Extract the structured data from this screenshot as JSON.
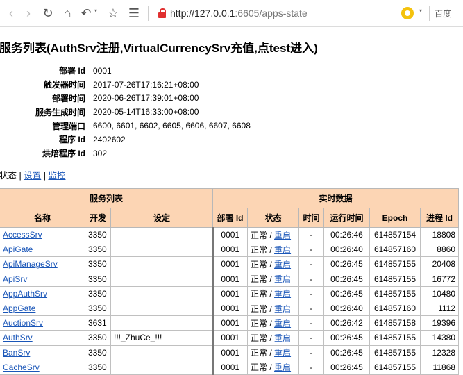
{
  "browser": {
    "url_host": "http://127.0.0.1",
    "url_rest": ":6605/apps-state",
    "search_engine": "百度"
  },
  "page": {
    "title": "服务列表(AuthSrv注册,VirtualCurrencySrv充值,点test进入)",
    "info": [
      {
        "label": "部署 Id",
        "value": "0001"
      },
      {
        "label": "触发器时间",
        "value": "2017-07-26T17:16:21+08:00"
      },
      {
        "label": "部署时间",
        "value": "2020-06-26T17:39:01+08:00"
      },
      {
        "label": "服务生成时间",
        "value": "2020-05-14T16:33:00+08:00"
      },
      {
        "label": "管理端口",
        "value": "6600, 6601, 6602, 6605, 6606, 6607, 6608"
      },
      {
        "label": "程序 Id",
        "value": "2402602"
      },
      {
        "label": "烘焙程序 Id",
        "value": "302"
      }
    ],
    "nav": {
      "state": "状态",
      "sep": "|",
      "settings": "设置",
      "monitor": "监控"
    }
  },
  "table": {
    "group_left": "服务列表",
    "group_right": "实时数据",
    "headers": [
      "名称",
      "开发",
      "设定",
      "部署 Id",
      "状态",
      "时间",
      "运行时间",
      "Epoch",
      "进程 Id"
    ],
    "status_text": "正常",
    "status_sep": "/",
    "restart_label": "重启",
    "rows": [
      {
        "name": "AccessSrv",
        "dev": "3350",
        "setting": "",
        "deploy": "0001",
        "time": "-",
        "uptime": "00:26:46",
        "epoch": "614857154",
        "pid": "18808"
      },
      {
        "name": "ApiGate",
        "dev": "3350",
        "setting": "",
        "deploy": "0001",
        "time": "-",
        "uptime": "00:26:40",
        "epoch": "614857160",
        "pid": "8860"
      },
      {
        "name": "ApiManageSrv",
        "dev": "3350",
        "setting": "",
        "deploy": "0001",
        "time": "-",
        "uptime": "00:26:45",
        "epoch": "614857155",
        "pid": "20408"
      },
      {
        "name": "ApiSrv",
        "dev": "3350",
        "setting": "",
        "deploy": "0001",
        "time": "-",
        "uptime": "00:26:45",
        "epoch": "614857155",
        "pid": "16772"
      },
      {
        "name": "AppAuthSrv",
        "dev": "3350",
        "setting": "",
        "deploy": "0001",
        "time": "-",
        "uptime": "00:26:45",
        "epoch": "614857155",
        "pid": "10480"
      },
      {
        "name": "AppGate",
        "dev": "3350",
        "setting": "",
        "deploy": "0001",
        "time": "-",
        "uptime": "00:26:40",
        "epoch": "614857160",
        "pid": "1112"
      },
      {
        "name": "AuctionSrv",
        "dev": "3631",
        "setting": "",
        "deploy": "0001",
        "time": "-",
        "uptime": "00:26:42",
        "epoch": "614857158",
        "pid": "19396"
      },
      {
        "name": "AuthSrv",
        "dev": "3350",
        "setting": "!!!_ZhuCe_!!!",
        "deploy": "0001",
        "time": "-",
        "uptime": "00:26:45",
        "epoch": "614857155",
        "pid": "14380"
      },
      {
        "name": "BanSrv",
        "dev": "3350",
        "setting": "",
        "deploy": "0001",
        "time": "-",
        "uptime": "00:26:45",
        "epoch": "614857155",
        "pid": "12328"
      },
      {
        "name": "CacheSrv",
        "dev": "3350",
        "setting": "",
        "deploy": "0001",
        "time": "-",
        "uptime": "00:26:45",
        "epoch": "614857155",
        "pid": "11868"
      }
    ]
  }
}
